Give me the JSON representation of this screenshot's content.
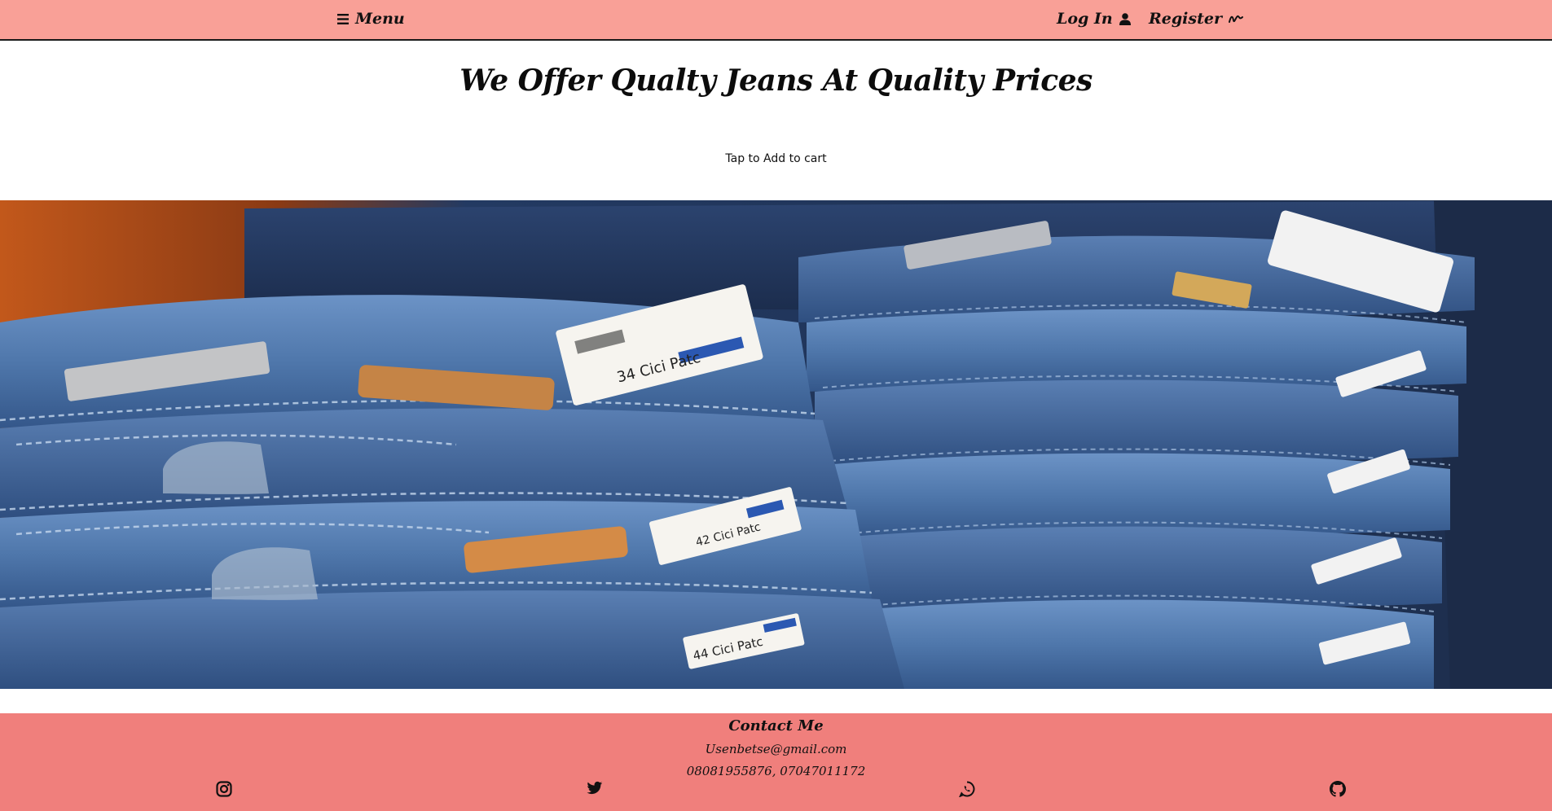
{
  "nav": {
    "menu_label": "Menu",
    "menu_icon": "hamburger-icon",
    "login_label": "Log In",
    "login_icon": "user-icon",
    "register_label": "Register",
    "register_icon": "signature-icon"
  },
  "hero": {
    "headline": "We Offer Qualty Jeans At Quality Prices",
    "subline": "Tap to Add to cart"
  },
  "banner": {
    "image": "stacked-jeans-photo",
    "tag_texts": [
      "34 Cici Patc",
      "42 Cici Patc",
      "44 Cici Patc"
    ]
  },
  "footer": {
    "title": "Contact Me",
    "email": "Usenbetse@gmail.com",
    "phone": "08081955876, 07047011172",
    "social_icons": [
      "instagram-icon",
      "twitter-icon",
      "whatsapp-icon",
      "github-icon"
    ]
  },
  "colors": {
    "topbar": "#f9a097",
    "footer": "#f07f7c",
    "denim": "#4a6ea0"
  }
}
